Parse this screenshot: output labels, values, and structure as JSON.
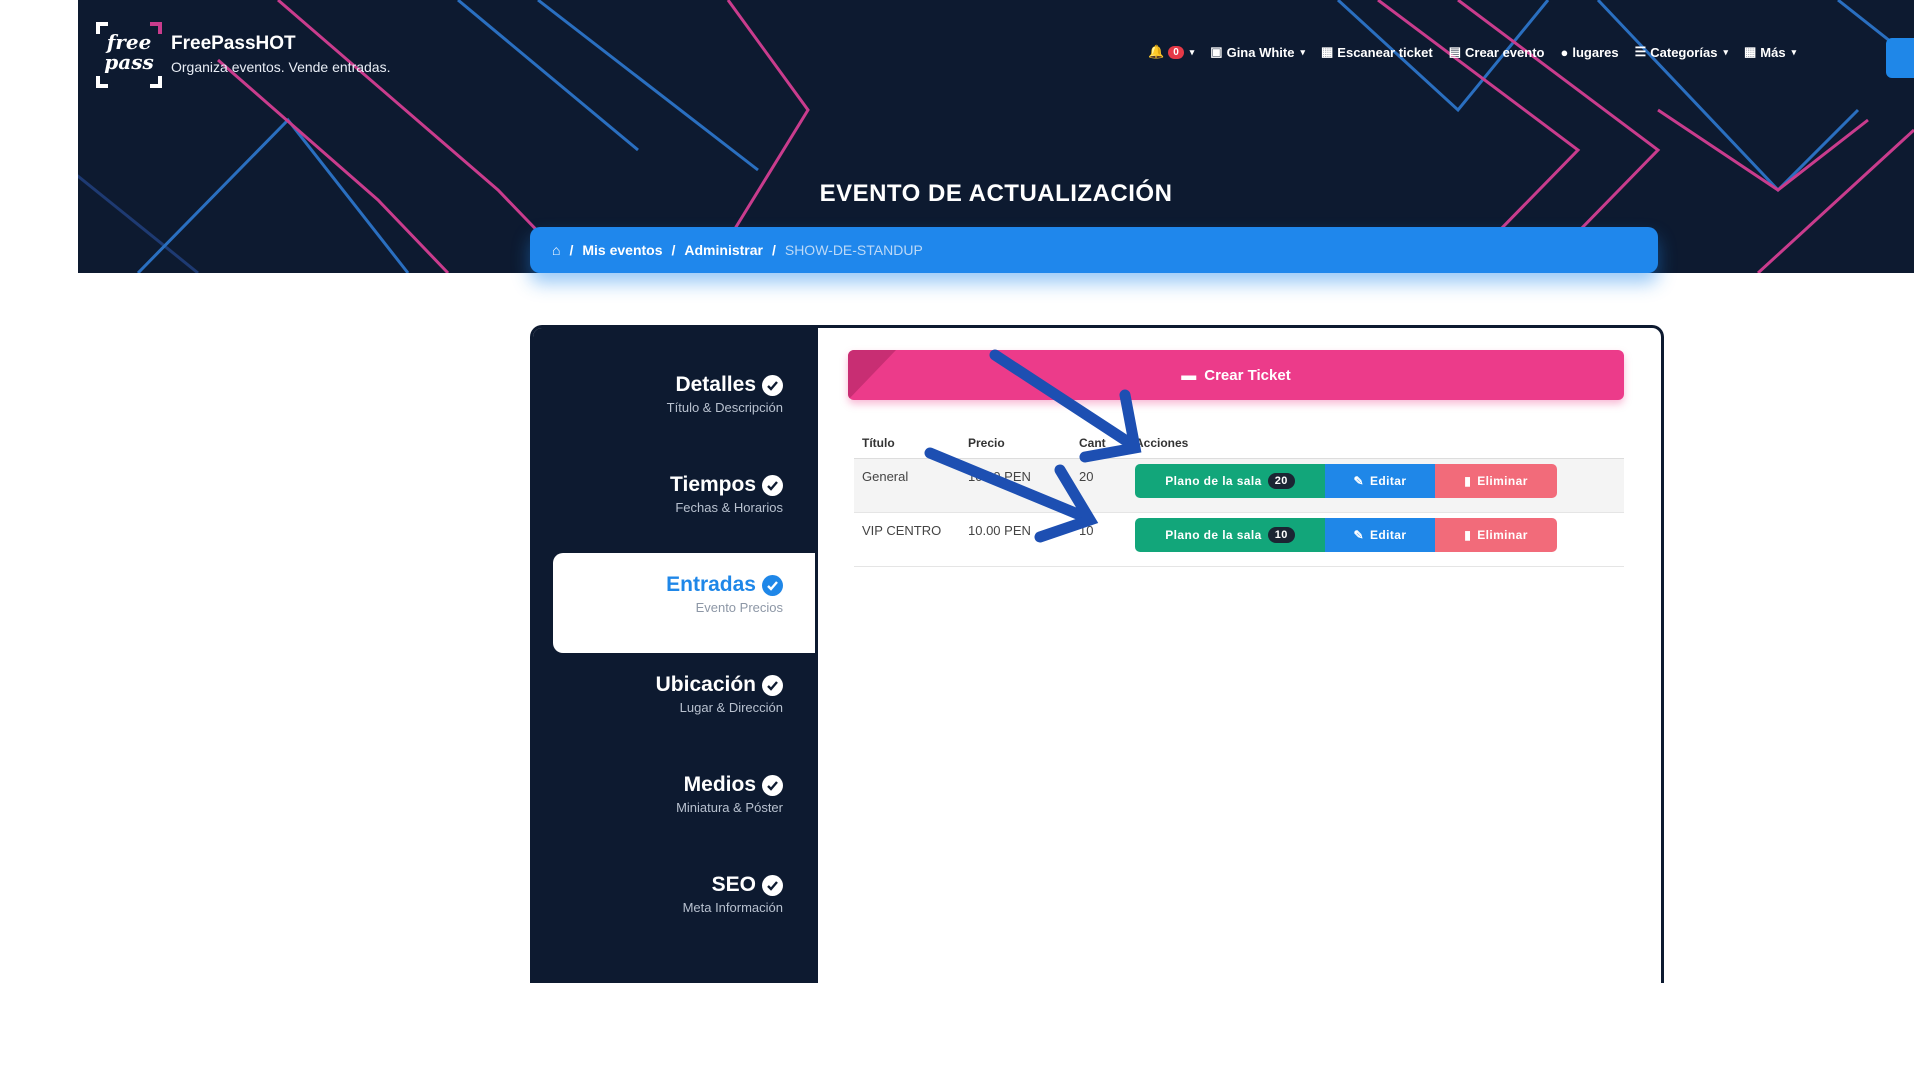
{
  "header": {
    "brand_logo_text_1": "free",
    "brand_logo_text_2": "pass",
    "brand_name": "FreePassHOT",
    "brand_tagline": "Organiza eventos. Vende entradas.",
    "notifications_count": "0",
    "user_name": "Gina White",
    "nav": {
      "scan": "Escanear ticket",
      "create": "Crear evento",
      "places": "lugares",
      "categories": "Categorías",
      "more": "Más"
    },
    "page_title": "EVENTO DE ACTUALIZACIÓN"
  },
  "breadcrumb": {
    "items": [
      "Mis eventos",
      "Administrar",
      "SHOW-DE-STANDUP"
    ],
    "separator": "/"
  },
  "sidebar": {
    "items": [
      {
        "title": "Detalles",
        "subtitle": "Título & Descripción"
      },
      {
        "title": "Tiempos",
        "subtitle": "Fechas & Horarios"
      },
      {
        "title": "Entradas",
        "subtitle": "Evento Precios"
      },
      {
        "title": "Ubicación",
        "subtitle": "Lugar & Dirección"
      },
      {
        "title": "Medios",
        "subtitle": "Miniatura & Póster"
      },
      {
        "title": "SEO",
        "subtitle": "Meta Información"
      }
    ],
    "active_index": 2
  },
  "tickets": {
    "create_label": "Crear Ticket",
    "columns": [
      "Título",
      "Precio",
      "Cant",
      "Acciones"
    ],
    "rows": [
      {
        "title": "General",
        "price": "10.00 PEN",
        "qty": "20",
        "seats": "20"
      },
      {
        "title": "VIP CENTRO",
        "price": "10.00 PEN",
        "qty": "10",
        "seats": "10"
      }
    ],
    "plan_label": "Plano de la sala",
    "edit_label": "Editar",
    "delete_label": "Eliminar"
  },
  "colors": {
    "navy": "#0d1a30",
    "blue": "#1f87e8",
    "pink": "#ec3b8a",
    "green": "#12a67a",
    "red": "#f26b7a",
    "annotation_arrow": "#1d4fb2"
  }
}
